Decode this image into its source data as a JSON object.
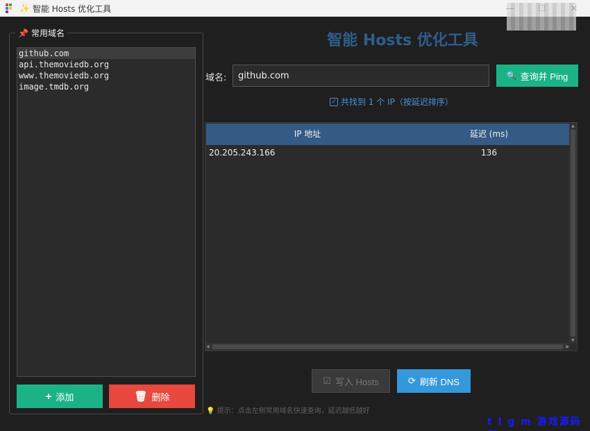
{
  "window": {
    "title": "智能 Hosts 优化工具",
    "controls": {
      "minimize": "—",
      "maximize": "☐",
      "close": "✕"
    }
  },
  "sidebar": {
    "legend": "常用域名",
    "domains": [
      {
        "label": "github.com",
        "selected": true
      },
      {
        "label": "api.themoviedb.org",
        "selected": false
      },
      {
        "label": "www.themoviedb.org",
        "selected": false
      },
      {
        "label": "image.tmdb.org",
        "selected": false
      }
    ],
    "add_label": "添加",
    "delete_label": "删除"
  },
  "main": {
    "title": "智能 Hosts 优化工具",
    "domain_label": "域名:",
    "domain_value": "github.com",
    "query_label": "查询并 Ping",
    "status": "共找到 1 个 IP（按延迟排序）",
    "table": {
      "headers": [
        "IP 地址",
        "延迟 (ms)"
      ],
      "rows": [
        {
          "ip": "20.205.243.166",
          "latency": "136"
        }
      ]
    },
    "write_label": "写入 Hosts",
    "refresh_label": "刷新 DNS",
    "tip": "提示：点击左侧常用域名快速查询，延迟越低越好"
  },
  "watermark": "t l g m 游戏源码网",
  "colors": {
    "accent_green": "#1cb287",
    "danger_red": "#e8483e",
    "info_blue": "#3498db",
    "header_blue": "#335b84",
    "title_blue": "#2f5d8c"
  }
}
